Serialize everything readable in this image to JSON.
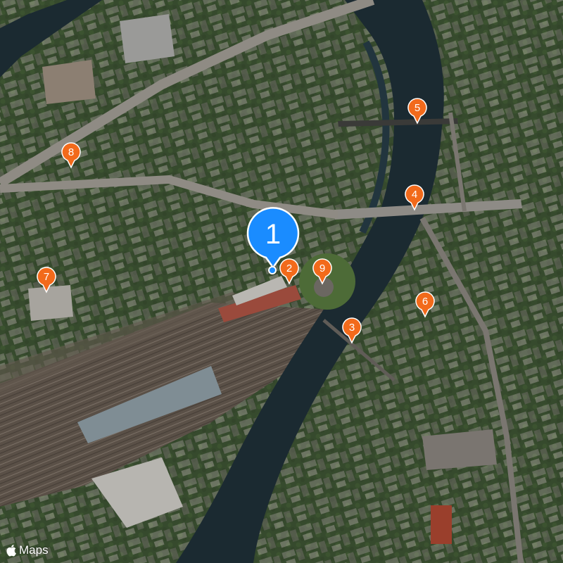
{
  "map": {
    "type": "satellite",
    "colors": {
      "river": "#1b2a31",
      "vegetation": "#3d5a2c",
      "urban": "#7d7a74",
      "rail": "#5e544b",
      "marker": "#f26a1b",
      "selected_marker": "#1a8cff"
    }
  },
  "markers": [
    {
      "label": "1",
      "selected": true
    },
    {
      "label": "2",
      "selected": false
    },
    {
      "label": "3",
      "selected": false
    },
    {
      "label": "4",
      "selected": false
    },
    {
      "label": "5",
      "selected": false
    },
    {
      "label": "6",
      "selected": false
    },
    {
      "label": "7",
      "selected": false
    },
    {
      "label": "8",
      "selected": false
    },
    {
      "label": "9",
      "selected": false
    }
  ],
  "attribution": {
    "text": "Maps",
    "icon": "apple-logo-icon"
  }
}
